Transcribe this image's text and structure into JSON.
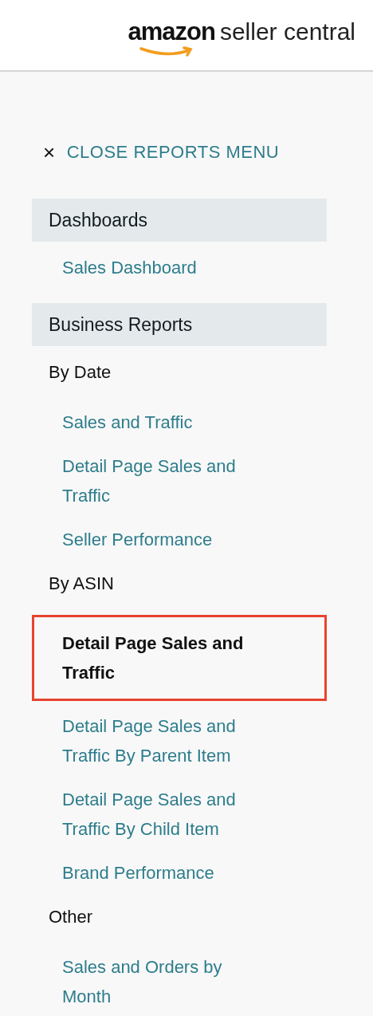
{
  "logo": {
    "brand": "amazon",
    "product": "seller central"
  },
  "close_link": {
    "icon": "×",
    "label": "CLOSE REPORTS MENU"
  },
  "sections": [
    {
      "title": "Dashboards",
      "groups": [
        {
          "items": [
            {
              "label": "Sales Dashboard",
              "selected": false
            }
          ]
        }
      ]
    },
    {
      "title": "Business Reports",
      "groups": [
        {
          "heading": "By Date",
          "items": [
            {
              "label": "Sales and Traffic",
              "selected": false
            },
            {
              "label": "Detail Page Sales and Traffic",
              "selected": false
            },
            {
              "label": "Seller Performance",
              "selected": false
            }
          ]
        },
        {
          "heading": "By ASIN",
          "items": [
            {
              "label": "Detail Page Sales and Traffic",
              "selected": true
            },
            {
              "label": "Detail Page Sales and Traffic By Parent Item",
              "selected": false
            },
            {
              "label": "Detail Page Sales and Traffic By Child Item",
              "selected": false
            },
            {
              "label": "Brand Performance",
              "selected": false
            }
          ]
        },
        {
          "heading": "Other",
          "items": [
            {
              "label": "Sales and Orders by Month",
              "selected": false
            }
          ]
        }
      ]
    }
  ]
}
